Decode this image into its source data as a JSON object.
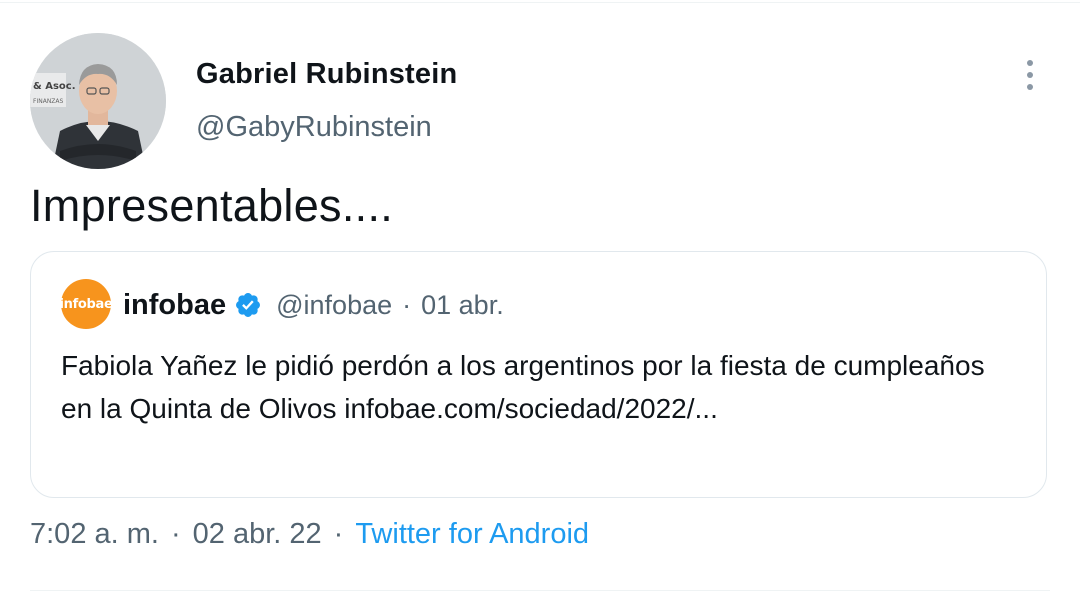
{
  "author": {
    "display_name": "Gabriel Rubinstein",
    "handle": "@GabyRubinstein",
    "avatar_sign_lines": [
      "& Asoc.",
      "FINANZAS"
    ]
  },
  "tweet": {
    "text": "Impresentables...."
  },
  "quoted_tweet": {
    "avatar_text": "infobae",
    "avatar_color": "#f7941d",
    "name": "infobae",
    "verified_icon": "verified-badge-icon",
    "handle": "@infobae",
    "separator": "·",
    "date": "01 abr.",
    "body": "Fabiola Yañez le pidió perdón a los argentinos por la fiesta de cumpleaños en la Quinta de Olivos infobae.com/sociedad/2022/..."
  },
  "meta": {
    "time": "7:02 a. m.",
    "separator": "·",
    "date": "02 abr. 22",
    "source": "Twitter for Android",
    "link_color": "#1d9bf0"
  },
  "menu_icon": "more-vertical-icon"
}
